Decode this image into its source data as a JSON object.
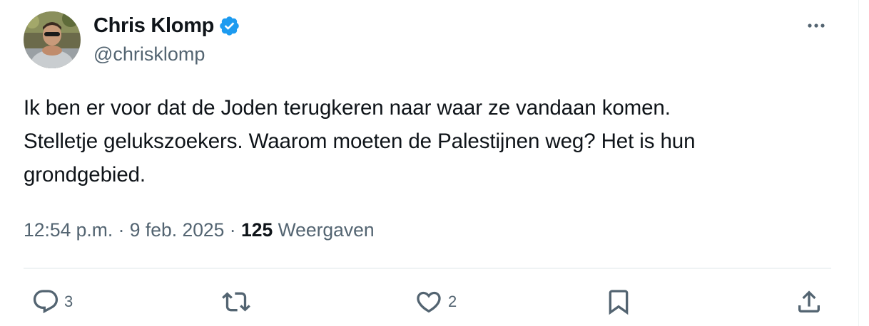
{
  "author": {
    "display_name": "Chris Klomp",
    "handle": "@chrisklomp",
    "verified": true,
    "verified_color": "#1d9bf0"
  },
  "tweet": {
    "text_lines": [
      "Ik ben er voor dat de Joden terugkeren naar waar ze vandaan komen.",
      "Stelletje gelukszoekers. Waarom moeten de Palestijnen weg? Het is hun",
      "grondgebied."
    ]
  },
  "meta": {
    "time": "12:54 p.m.",
    "separator": "·",
    "date": "9 feb. 2025",
    "views_count": "125",
    "views_label": "Weergaven"
  },
  "actions": {
    "reply_icon": "reply-icon",
    "reply_count": "3",
    "retweet_icon": "retweet-icon",
    "like_icon": "heart-icon",
    "like_count": "2",
    "bookmark_icon": "bookmark-icon",
    "share_icon": "share-icon"
  },
  "colors": {
    "text_primary": "#0f1419",
    "text_secondary": "#536471",
    "divider": "#eff3f4"
  }
}
